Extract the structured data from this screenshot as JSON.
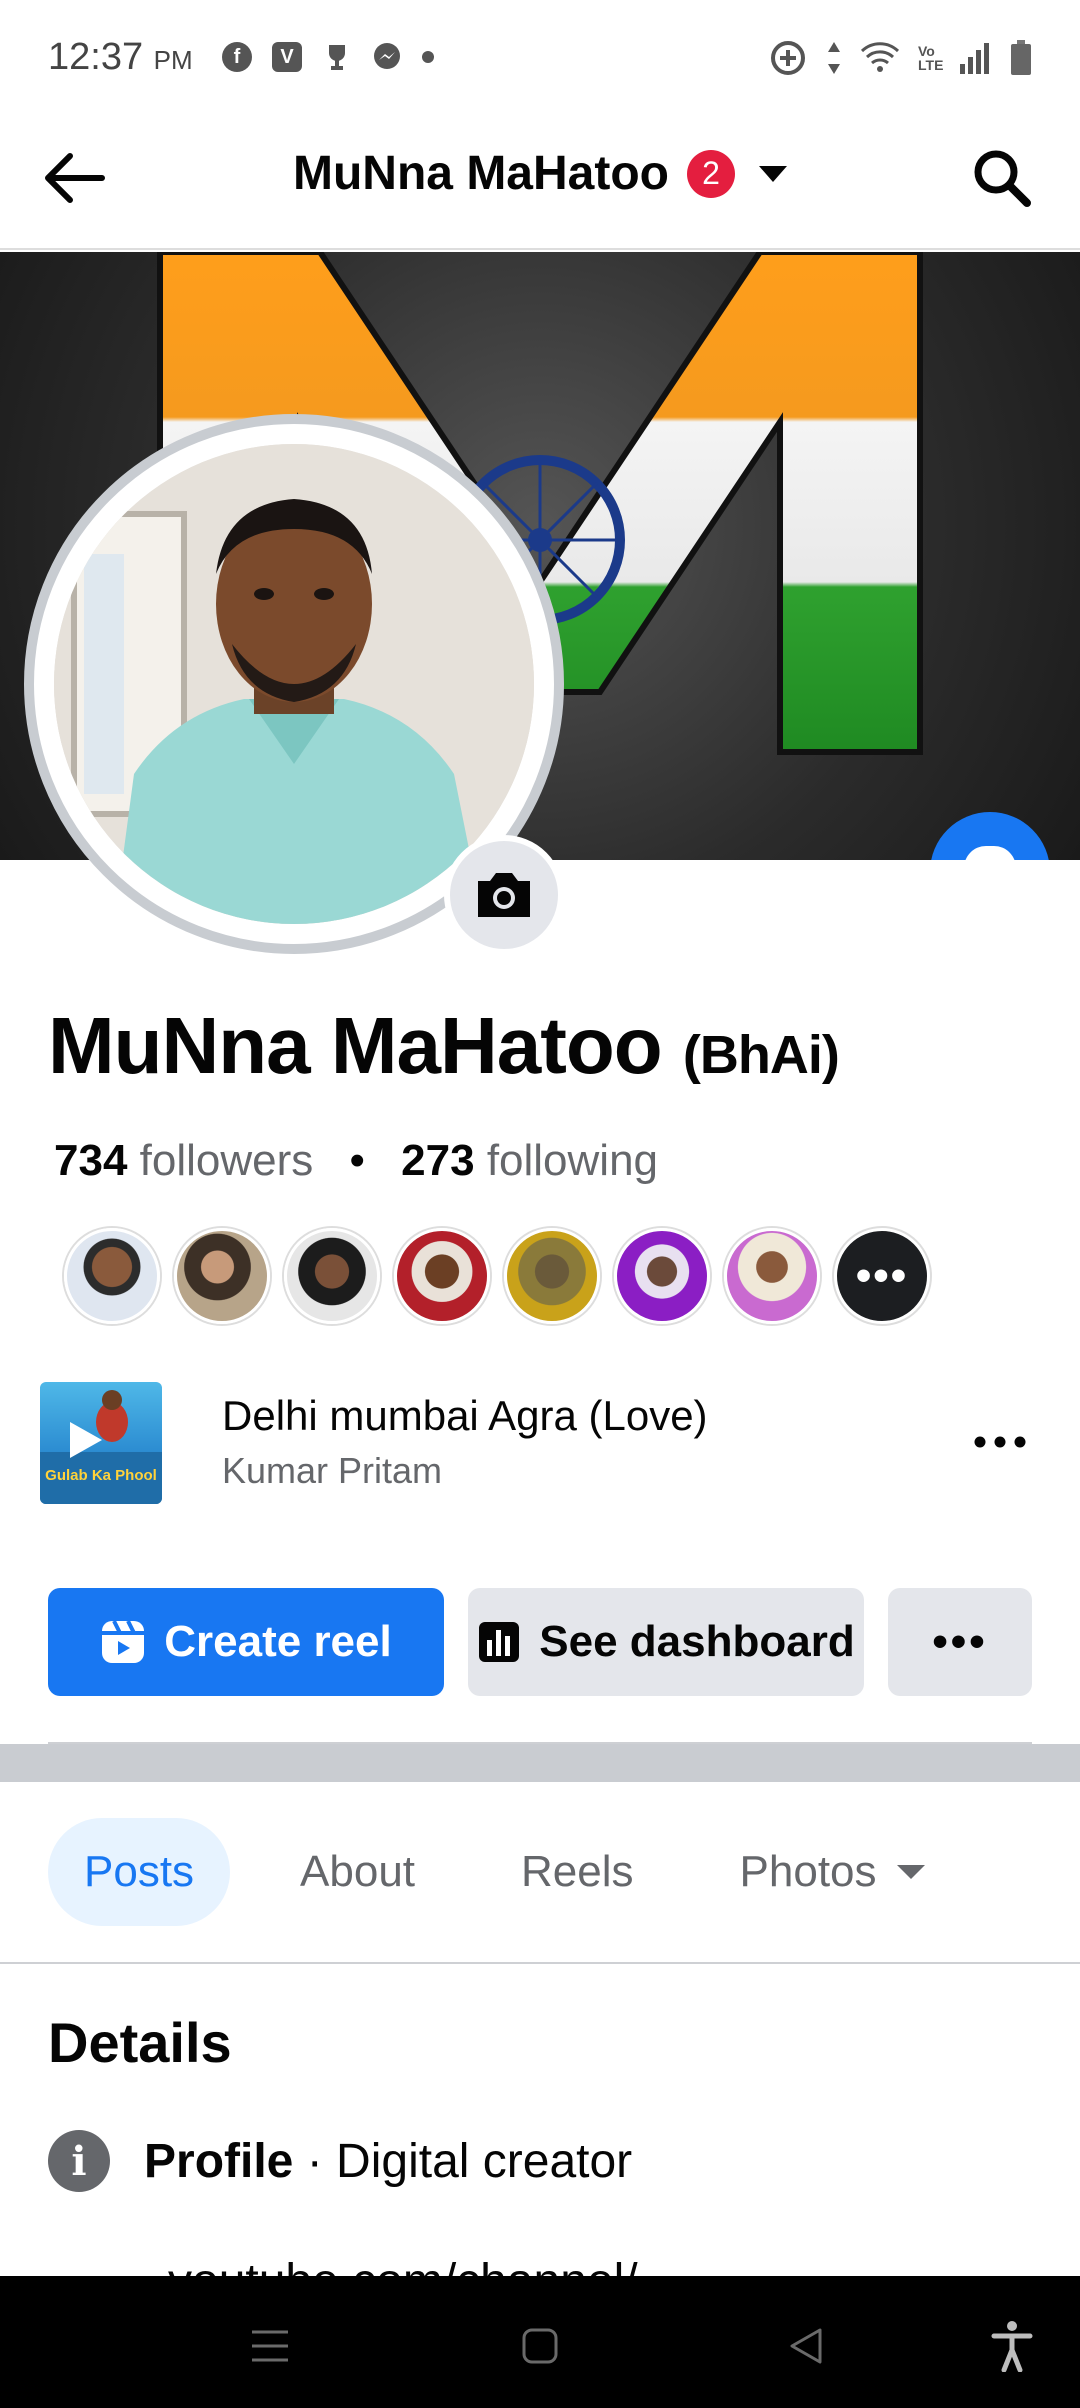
{
  "status_bar": {
    "time": "12:37",
    "ampm": "PM",
    "left_icons": [
      "facebook-icon",
      "vimeo-icon",
      "trophy-icon",
      "messenger-icon",
      "dot-icon"
    ],
    "right_icons": [
      "data-saver-icon",
      "data-arrows-icon",
      "wifi-icon",
      "volte-icon",
      "signal-icon",
      "battery-icon"
    ],
    "volte_text": "Vo LTE"
  },
  "header": {
    "title": "MuNna MaHatoo",
    "badge_count": "2"
  },
  "profile": {
    "name": "MuNna MaHatoo",
    "alt_name": "(BhAi)",
    "followers_count": "734",
    "followers_label": "followers",
    "separator": "•",
    "following_count": "273",
    "following_label": "following",
    "friends_more": "•••"
  },
  "music": {
    "title": "Delhi mumbai Agra (Love)",
    "artist": "Kumar Pritam",
    "cover_text": "Gulab Ka Phool"
  },
  "actions": {
    "create_reel": "Create reel",
    "see_dashboard": "See dashboard",
    "more": "•••"
  },
  "tabs": [
    {
      "label": "Posts",
      "active": true
    },
    {
      "label": "About",
      "active": false
    },
    {
      "label": "Reels",
      "active": false
    },
    {
      "label": "Photos",
      "active": false
    }
  ],
  "details": {
    "title": "Details",
    "profile_label": "Profile",
    "profile_sep": "·",
    "profile_value": "Digital creator",
    "cut_text": "youtube.com/channel/"
  },
  "colors": {
    "accent": "#1877f2",
    "badge": "#e41e3f",
    "secondary_bg": "#e4e6eb",
    "muted_text": "#65676b"
  }
}
